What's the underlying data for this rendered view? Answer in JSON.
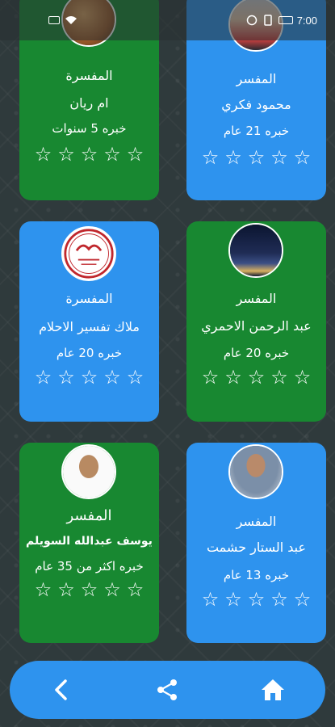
{
  "status_bar": {
    "time": "7:00",
    "icons": [
      "notification-icon",
      "wifi-icon",
      "battery-icon"
    ]
  },
  "cards": [
    {
      "id": "c1",
      "color": "#188831",
      "role": "المفسرة",
      "name": "ام ريان",
      "experience": "خبره 5 سنوات",
      "rating": 0,
      "stars_total": 5,
      "avatar": "food-photo"
    },
    {
      "id": "c2",
      "color": "#2e93ee",
      "role": "المفسر",
      "name": "محمود فكري",
      "experience": "خبره 21 عام",
      "rating": 0,
      "stars_total": 5,
      "avatar": "man-photo"
    },
    {
      "id": "c3",
      "color": "#2e93ee",
      "role": "المفسرة",
      "name": "ملاك تفسير الاحلام",
      "experience": "خبره 20 عام",
      "rating": 0,
      "stars_total": 5,
      "avatar": "logo-malak"
    },
    {
      "id": "c4",
      "color": "#188831",
      "role": "المفسر",
      "name": "عبد الرحمن الاحمري",
      "experience": "خبره 20 عام",
      "rating": 0,
      "stars_total": 5,
      "avatar": "city-night-photo"
    },
    {
      "id": "c5",
      "color": "#188831",
      "role": "المفسر",
      "name": "يوسف عبدالله السويلم",
      "experience": "خبره اكثر من 35 عام",
      "rating": 0,
      "stars_total": 5,
      "avatar": "man-ghutra-photo"
    },
    {
      "id": "c6",
      "color": "#2e93ee",
      "role": "المفسر",
      "name": "عبد الستار حشمت",
      "experience": "خبره 13 عام",
      "rating": 0,
      "stars_total": 5,
      "avatar": "man-suit-photo"
    }
  ],
  "bottom_nav": {
    "items": [
      {
        "name": "back",
        "icon": "chevron-left-icon"
      },
      {
        "name": "share",
        "icon": "share-icon"
      },
      {
        "name": "home",
        "icon": "home-icon"
      }
    ]
  },
  "colors": {
    "green_card": "#188831",
    "blue_card": "#2e93ee",
    "background": "#2f3a3c",
    "nav": "#2e93ee"
  }
}
